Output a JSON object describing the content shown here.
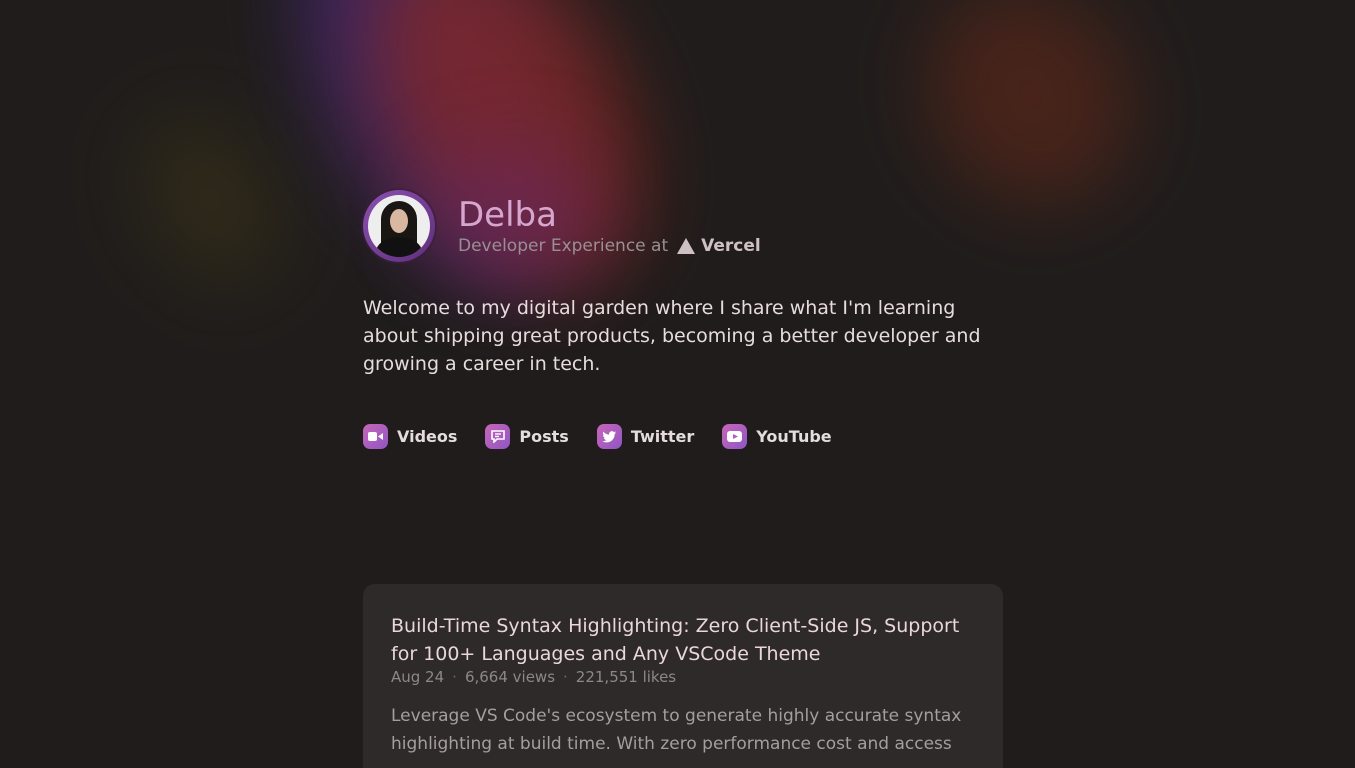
{
  "profile": {
    "name": "Delba",
    "role_prefix": "Developer Experience at",
    "company": "Vercel",
    "avatar_alt": ""
  },
  "intro": "Welcome to my digital garden where I share what I'm learning about shipping great products, becoming a better developer and growing a career in tech.",
  "links": [
    {
      "label": "Videos",
      "icon": "video-icon"
    },
    {
      "label": "Posts",
      "icon": "chat-icon"
    },
    {
      "label": "Twitter",
      "icon": "twitter-icon"
    },
    {
      "label": "YouTube",
      "icon": "youtube-icon"
    }
  ],
  "post": {
    "title": "Build-Time Syntax Highlighting: Zero Client-Side JS, Support for 100+ Languages and Any VSCode Theme",
    "date": "Aug 24",
    "views": "6,664 views",
    "likes": "221,551 likes",
    "description": "Leverage VS Code's ecosystem to generate highly accurate syntax highlighting at build time. With zero performance cost and access"
  },
  "colors": {
    "background": "#1f1c1b",
    "accent": "#c866b8",
    "name": "#d6a6cf"
  }
}
